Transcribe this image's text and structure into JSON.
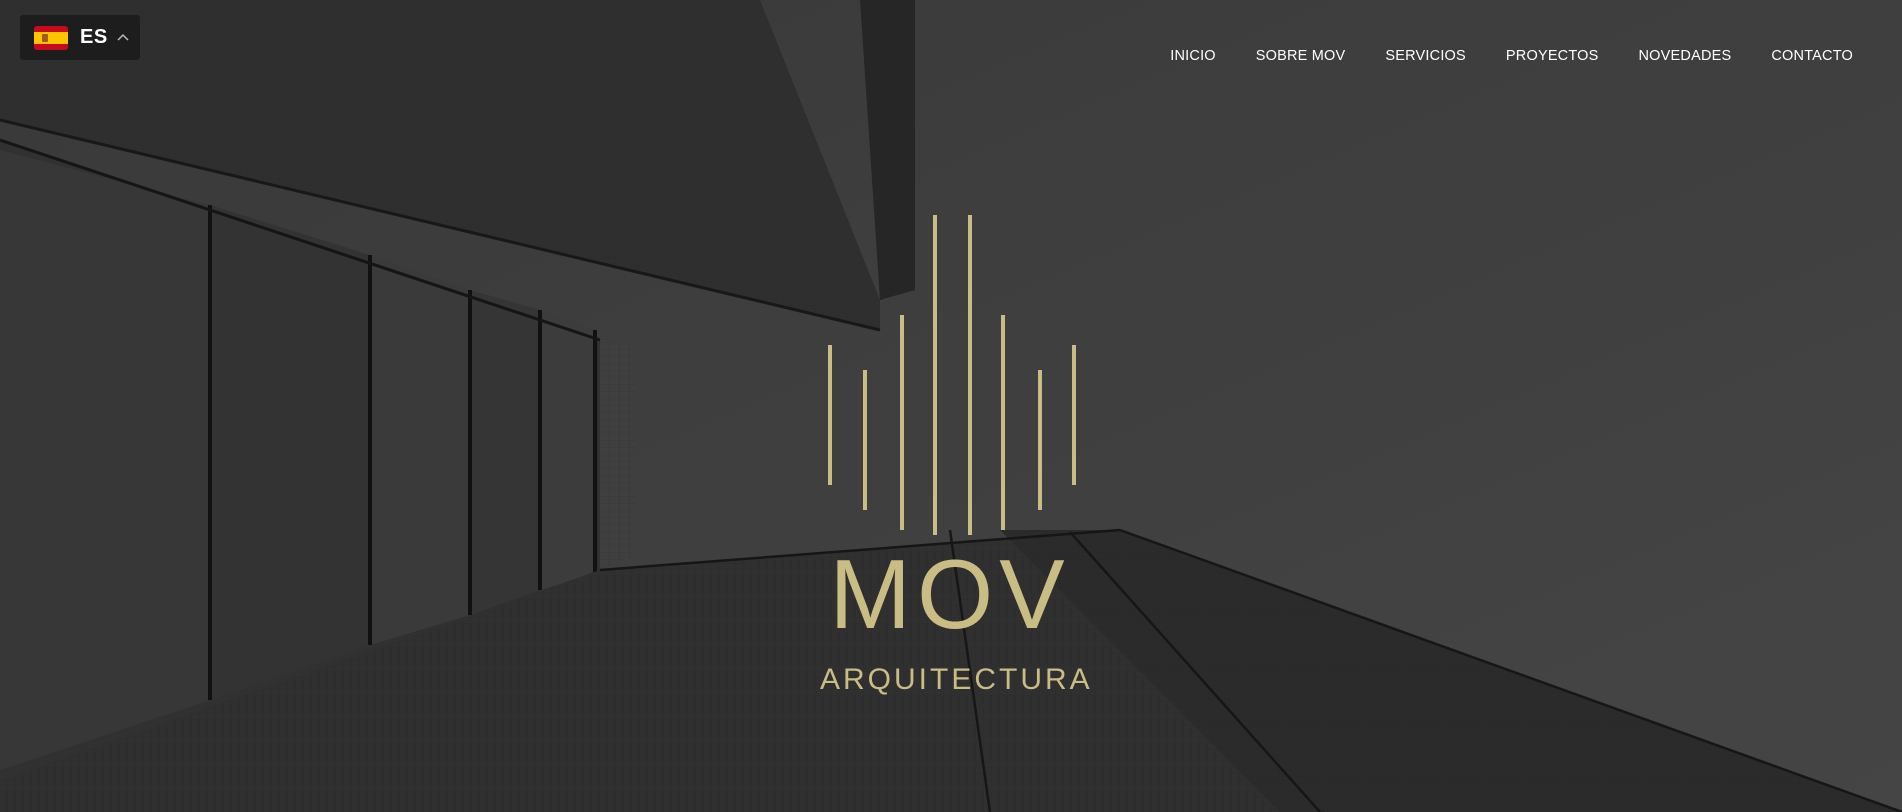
{
  "language_switcher": {
    "code": "ES",
    "flag_icon": "spain-flag-icon",
    "toggle_icon": "chevron-up-icon"
  },
  "nav": {
    "items": [
      {
        "label": "INICIO"
      },
      {
        "label": "SOBRE MOV"
      },
      {
        "label": "SERVICIOS"
      },
      {
        "label": "PROYECTOS"
      },
      {
        "label": "NOVEDADES"
      },
      {
        "label": "CONTACTO"
      }
    ]
  },
  "brand": {
    "name": "MOV",
    "tagline": "ARQUITECTURA",
    "color": "#c9bd84"
  },
  "colors": {
    "overlay_dark": "#3a3a3a",
    "nav_text": "#ffffff"
  }
}
